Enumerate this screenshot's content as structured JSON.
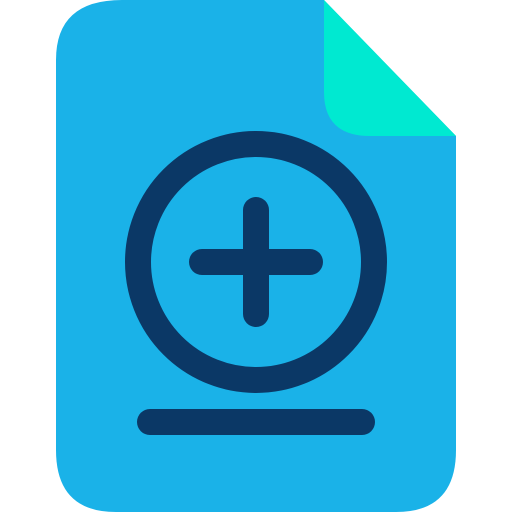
{
  "icon": {
    "name": "add-file-icon",
    "colors": {
      "page": "#1ab2e8",
      "fold": "#00e9d1",
      "stroke": "#0b3866",
      "background": "#ffffff"
    }
  }
}
